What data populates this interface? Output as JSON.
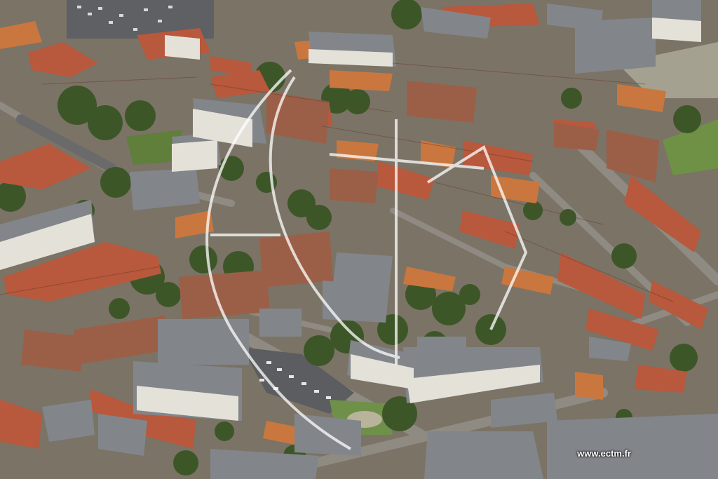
{
  "photo": {
    "description_kind": "aerial-city-photo",
    "watermark_brand": "ECTM"
  },
  "credit": {
    "text": "www.ectm.fr"
  },
  "colors": {
    "roof_red": "#b5533a",
    "roof_orange": "#c8703f",
    "roof_grey": "#7e8286",
    "brick": "#9a5a44",
    "tree": "#3f5a2c",
    "grass": "#6f8f45",
    "street": "#8d8a84",
    "parking": "#5b5c5e",
    "watermark": "#ffffff"
  }
}
